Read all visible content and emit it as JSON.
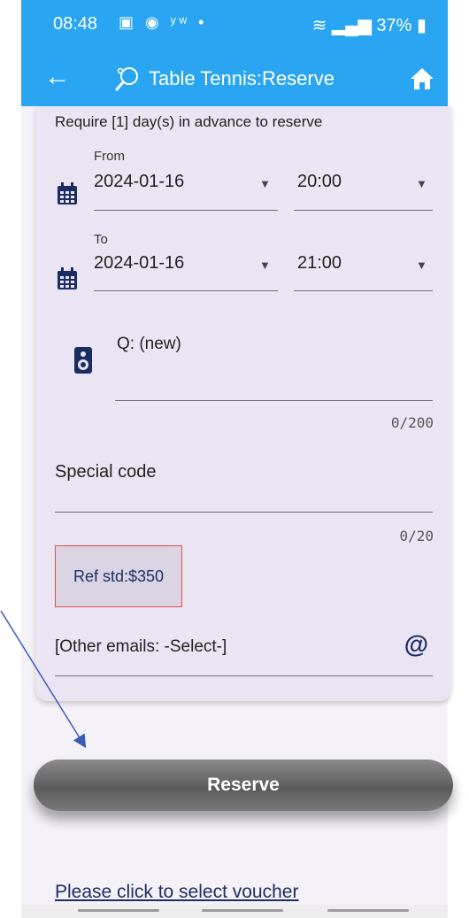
{
  "status_bar": {
    "time": "08:48",
    "left_icons": "▣ ◉ ʸʷ •",
    "signal": "37%"
  },
  "app_bar": {
    "title": "Table Tennis:Reserve",
    "back_icon": "arrow-left",
    "home_icon": "home",
    "accent_color": "#2aa5f1"
  },
  "form": {
    "advance_note": "Require [1] day(s) in advance to reserve",
    "from": {
      "label": "From",
      "date": "2024-01-16",
      "time": "20:00"
    },
    "to": {
      "label": "To",
      "date": "2024-01-16",
      "time": "21:00"
    },
    "q": {
      "label": "Q: (new)",
      "counter": "0/200"
    },
    "special_code": {
      "label": "Special code",
      "counter": "0/20"
    },
    "ref_std": "Ref std:$350",
    "other_emails": "[Other emails: -Select-]",
    "at_symbol": "@"
  },
  "actions": {
    "reserve_label": "Reserve",
    "voucher_link": "Please click to select voucher"
  }
}
